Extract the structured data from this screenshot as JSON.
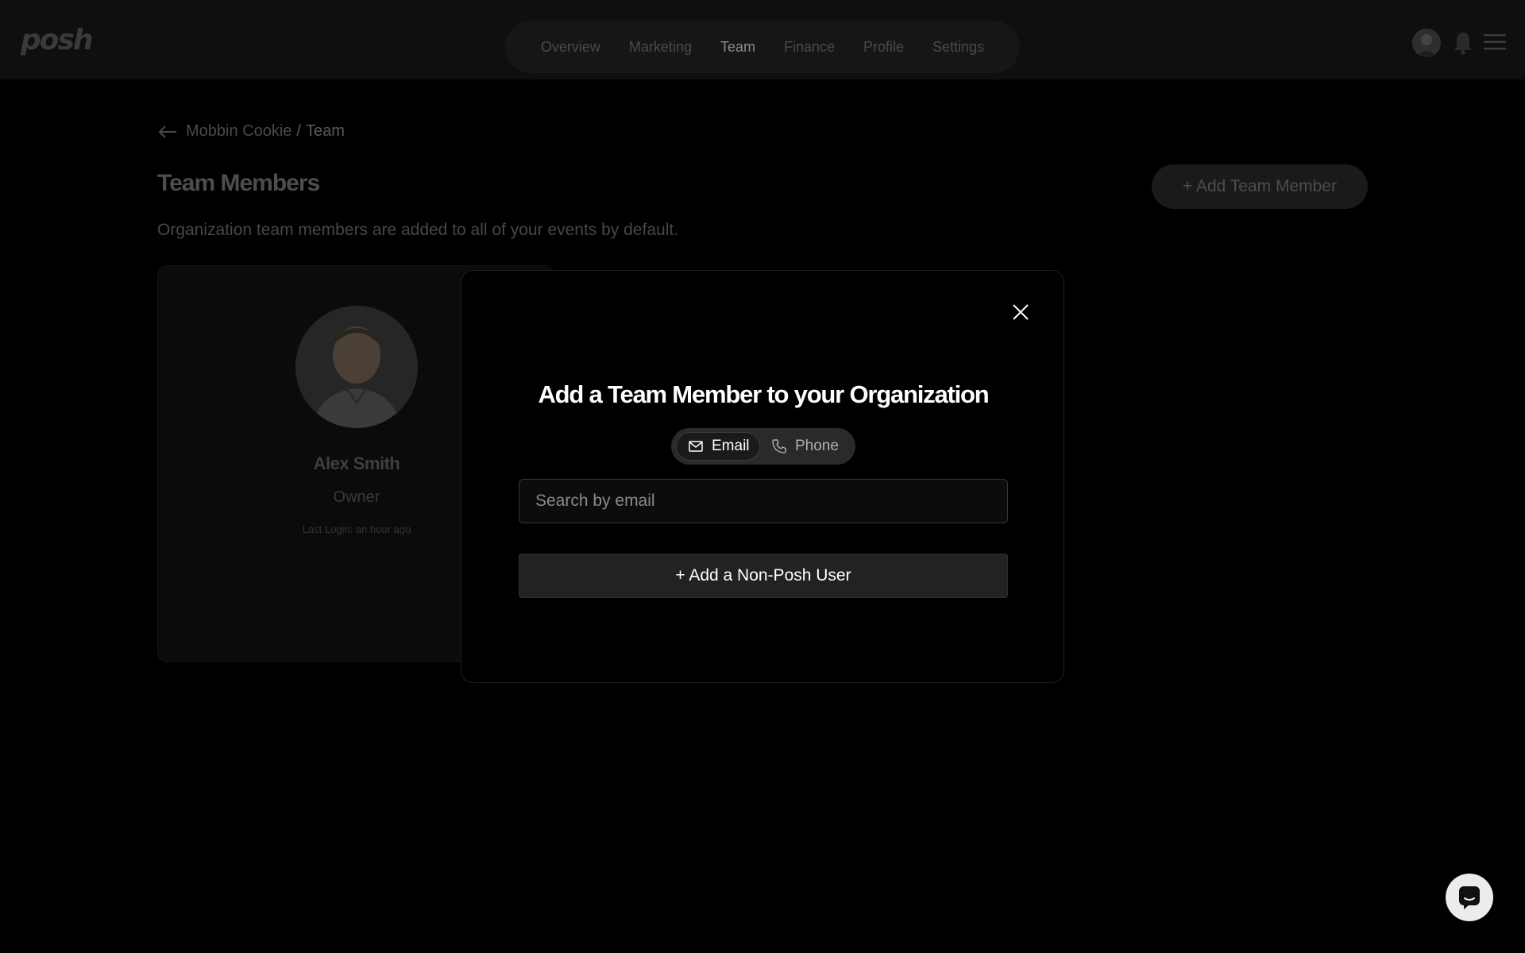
{
  "app": {
    "logo_text": "posh"
  },
  "nav": {
    "items": [
      {
        "label": "Overview"
      },
      {
        "label": "Marketing"
      },
      {
        "label": "Team",
        "active": true
      },
      {
        "label": "Finance"
      },
      {
        "label": "Profile"
      },
      {
        "label": "Settings"
      }
    ]
  },
  "header_icons": {
    "avatar": "user-avatar",
    "notifications": "bell-icon",
    "menu": "hamburger-menu-icon"
  },
  "breadcrumb": {
    "org": "Mobbin Cookie",
    "separator": "/",
    "current": "Team"
  },
  "page": {
    "title": "Team Members",
    "subtitle": "Organization team members are added to all of your events by default.",
    "add_button": "+ Add Team Member"
  },
  "members": [
    {
      "name": "Alex Smith",
      "role": "Owner",
      "last_login": "Last Login: an hour ago"
    }
  ],
  "modal": {
    "title": "Add a Team Member to your Organization",
    "toggle": {
      "email_label": "Email",
      "phone_label": "Phone",
      "selected": "Email"
    },
    "search_placeholder": "Search by email",
    "non_posh_button": "+ Add a Non-Posh User"
  },
  "colors": {
    "background": "#000000",
    "modal_border": "#1e1e1e",
    "chat_bubble": "#ececec"
  }
}
